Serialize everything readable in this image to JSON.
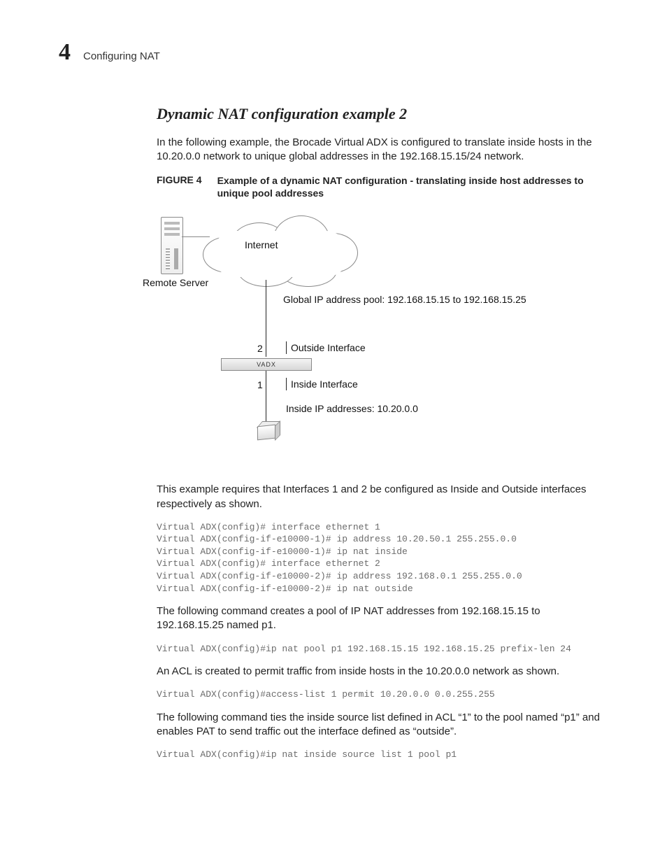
{
  "header": {
    "chapter_number": "4",
    "chapter_title": "Configuring NAT"
  },
  "section": {
    "title": "Dynamic NAT configuration example 2",
    "intro": "In the following example, the Brocade Virtual ADX is configured to translate inside hosts in the 10.20.0.0 network to unique global addresses in the 192.168.15.15/24 network."
  },
  "figure": {
    "label": "FIGURE 4",
    "caption": "Example of a dynamic NAT configuration - translating inside host addresses to unique pool addresses",
    "labels": {
      "remote_server": "Remote Server",
      "internet": "Internet",
      "pool": "Global IP address pool: 192.168.15.15 to 192.168.15.25",
      "port2": "2",
      "outside_if": "Outside Interface",
      "vadx": "VADX",
      "port1": "1",
      "inside_if": "Inside Interface",
      "inside_ip": "Inside IP addresses: 10.20.0.0"
    }
  },
  "para_interfaces": "This example requires that Interfaces 1 and 2 be configured as Inside and Outside interfaces respectively as shown.",
  "code_interfaces": "Virtual ADX(config)# interface ethernet 1\nVirtual ADX(config-if-e10000-1)# ip address 10.20.50.1 255.255.0.0\nVirtual ADX(config-if-e10000-1)# ip nat inside\nVirtual ADX(config)# interface ethernet 2\nVirtual ADX(config-if-e10000-2)# ip address 192.168.0.1 255.255.0.0\nVirtual ADX(config-if-e10000-2)# ip nat outside",
  "para_pool": "The following command creates a pool of IP NAT addresses from 192.168.15.15 to 192.168.15.25 named p1.",
  "code_pool": "Virtual ADX(config)#ip nat pool p1 192.168.15.15 192.168.15.25 prefix-len 24",
  "para_acl": "An ACL is created to permit traffic from inside hosts in the 10.20.0.0 network as shown.",
  "code_acl": "Virtual ADX(config)#access-list 1 permit 10.20.0.0 0.0.255.255",
  "para_tie": "The following command ties the inside source list defined in ACL “1” to the pool named “p1” and enables PAT to send traffic out the interface defined as “outside”.",
  "code_tie": "Virtual ADX(config)#ip nat inside source list 1 pool p1"
}
